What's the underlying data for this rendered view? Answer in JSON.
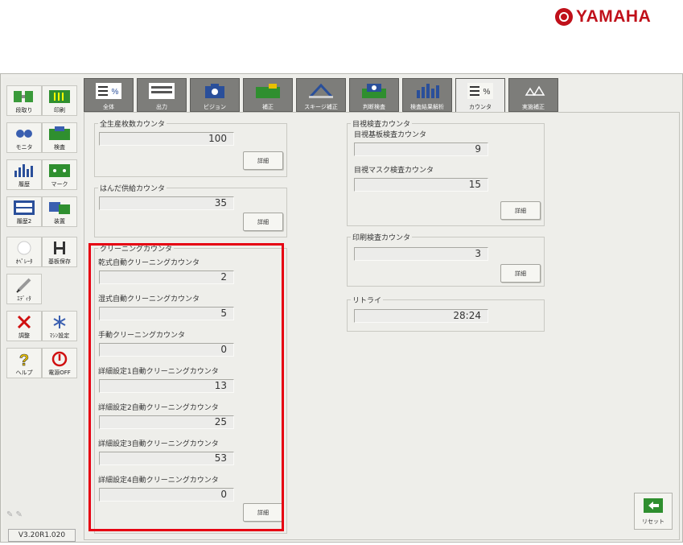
{
  "logo": {
    "text": "YAMAHA"
  },
  "sidebar": {
    "buttons": [
      {
        "label": "段取り"
      },
      {
        "label": "印刷"
      },
      {
        "label": "モニタ"
      },
      {
        "label": "検査"
      },
      {
        "label": "履歴"
      },
      {
        "label": "マーク"
      },
      {
        "label": "履歴2"
      },
      {
        "label": "装置"
      },
      {
        "label": "ｵﾍﾟﾚｰﾀ"
      },
      {
        "label": "基板保存"
      },
      {
        "label": "ｴﾃﾞｨﾀ"
      },
      {
        "label": "調整"
      },
      {
        "label": "ﾏｼﾝ設定"
      },
      {
        "label": "ヘルプ"
      },
      {
        "label": "電源OFF"
      }
    ],
    "version": "V3.20R1.020"
  },
  "tabs": [
    {
      "label": "全体"
    },
    {
      "label": "出力"
    },
    {
      "label": "ビジョン"
    },
    {
      "label": "補正"
    },
    {
      "label": "スキージ補正"
    },
    {
      "label": "判断検査"
    },
    {
      "label": "検査結果解析"
    },
    {
      "label": "カウンタ"
    },
    {
      "label": "実施補正"
    }
  ],
  "groups": {
    "total": {
      "title": "全生産枚数カウンタ",
      "value": "100",
      "button": "詳細"
    },
    "solder": {
      "title": "はんだ供給カウンタ",
      "value": "35",
      "button": "詳細"
    },
    "cleaning": {
      "title": "クリーニングカウンタ",
      "rows": [
        {
          "label": "乾式自動クリーニングカウンタ",
          "value": "2"
        },
        {
          "label": "湿式自動クリーニングカウンタ",
          "value": "5"
        },
        {
          "label": "手動クリーニングカウンタ",
          "value": "0"
        },
        {
          "label": "詳細設定1自動クリーニングカウンタ",
          "value": "13"
        },
        {
          "label": "詳細設定2自動クリーニングカウンタ",
          "value": "25"
        },
        {
          "label": "詳細設定3自動クリーニングカウンタ",
          "value": "53"
        },
        {
          "label": "詳細設定4自動クリーニングカウンタ",
          "value": "0"
        }
      ],
      "button": "詳細"
    },
    "visual": {
      "title": "目視検査カウンタ",
      "rows": [
        {
          "label": "目視基板検査カウンタ",
          "value": "9"
        },
        {
          "label": "目視マスク検査カウンタ",
          "value": "15"
        }
      ],
      "button": "詳細"
    },
    "print_inspect": {
      "title": "印刷検査カウンタ",
      "value": "3",
      "button": "詳細"
    },
    "retry": {
      "title": "リトライ",
      "value": "28:24"
    }
  },
  "reset": {
    "label": "リセット"
  },
  "colors": {
    "highlight": "#e60012",
    "logo": "#c0101a",
    "tab_inactive": "#7d7d7a"
  }
}
